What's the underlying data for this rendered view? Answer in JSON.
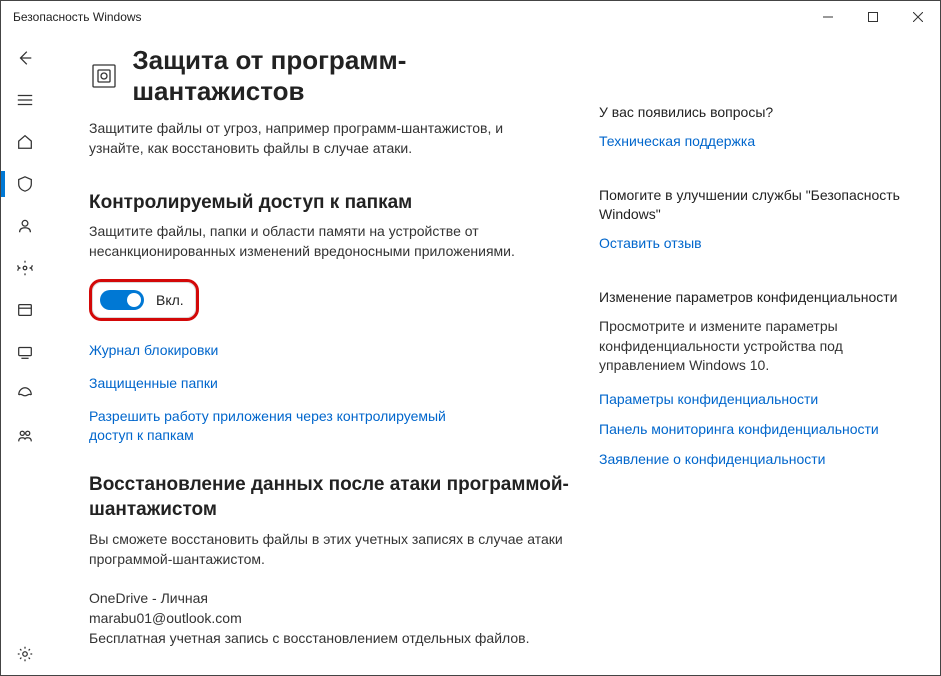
{
  "window": {
    "title": "Безопасность Windows"
  },
  "page": {
    "title": "Защита от программ-шантажистов",
    "description": "Защитите файлы от угроз, например программ-шантажистов, и узнайте, как восстановить файлы в случае атаки."
  },
  "cfa": {
    "title": "Контролируемый доступ к папкам",
    "description": "Защитите файлы, папки и области памяти на устройстве от несанкционированных изменений вредоносными приложениями.",
    "toggle_label": "Вкл.",
    "links": {
      "history": "Журнал блокировки",
      "protected": "Защищенные папки",
      "allow": "Разрешить работу приложения через контролируемый доступ к папкам"
    }
  },
  "recovery": {
    "title": "Восстановление данных после атаки программой-шантажистом",
    "description": "Вы сможете восстановить файлы в этих учетных записях в случае атаки программой-шантажистом.",
    "onedrive": {
      "name": "OneDrive - Личная",
      "email": "marabu01@outlook.com",
      "note": "Бесплатная учетная запись с восстановлением отдельных файлов."
    }
  },
  "right": {
    "questions": {
      "title": "У вас появились вопросы?",
      "link": "Техническая поддержка"
    },
    "feedback": {
      "title": "Помогите в улучшении службы \"Безопасность Windows\"",
      "link": "Оставить отзыв"
    },
    "privacy": {
      "title": "Изменение параметров конфиденциальности",
      "description": "Просмотрите и измените параметры конфиденциальности устройства под управлением Windows 10.",
      "links": {
        "settings": "Параметры конфиденциальности",
        "dashboard": "Панель мониторинга конфиденциальности",
        "statement": "Заявление о конфиденциальности"
      }
    }
  }
}
